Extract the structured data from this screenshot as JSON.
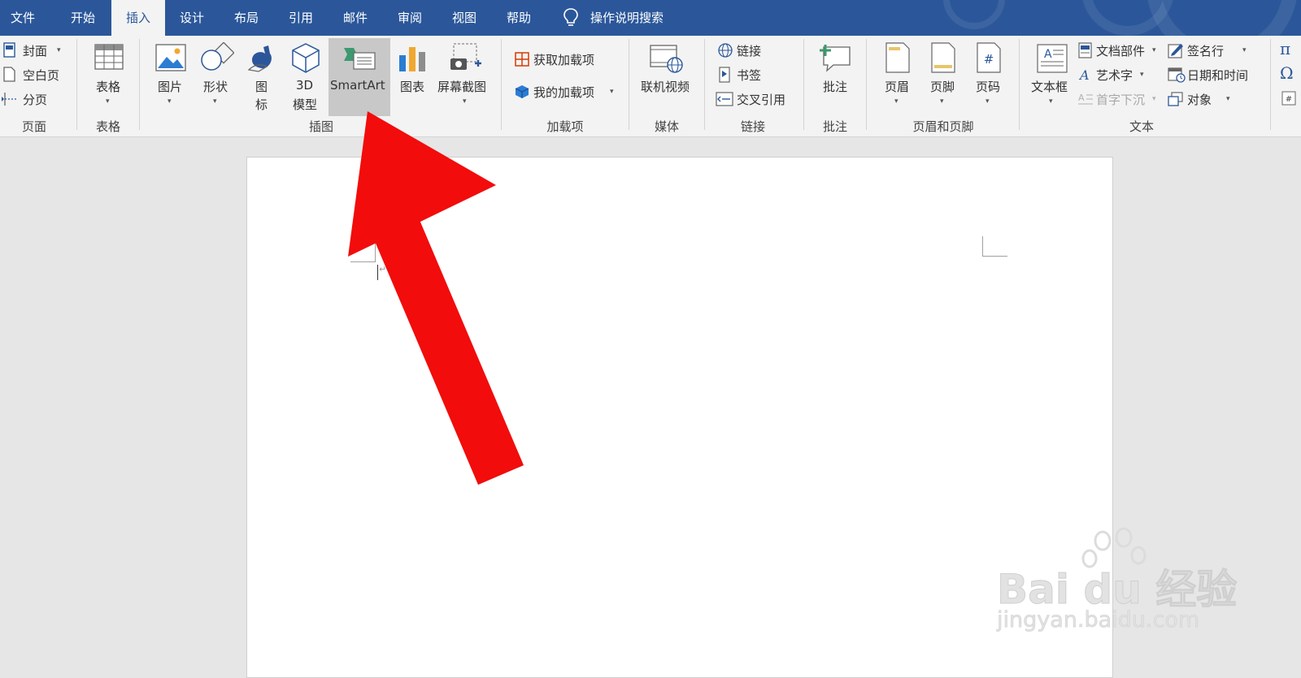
{
  "tabs": [
    {
      "label": "文件",
      "active": false
    },
    {
      "label": "开始",
      "active": false
    },
    {
      "label": "插入",
      "active": true
    },
    {
      "label": "设计",
      "active": false
    },
    {
      "label": "布局",
      "active": false
    },
    {
      "label": "引用",
      "active": false
    },
    {
      "label": "邮件",
      "active": false
    },
    {
      "label": "审阅",
      "active": false
    },
    {
      "label": "视图",
      "active": false
    },
    {
      "label": "帮助",
      "active": false
    }
  ],
  "tell_me": {
    "label": "操作说明搜索",
    "icon": "lightbulb-icon"
  },
  "groups": {
    "pages": {
      "label": "页面",
      "cover": "封面",
      "blank": "空白页",
      "break": "分页"
    },
    "tables": {
      "label": "表格",
      "table": "表格"
    },
    "illustrations": {
      "label": "插图",
      "pictures": "图片",
      "shapes": "形状",
      "icons_l1": "图",
      "icons_l2": "标",
      "model_l1": "3D",
      "model_l2": "模型",
      "smartart": "SmartArt",
      "chart": "图表",
      "screenshot": "屏幕截图"
    },
    "addins": {
      "label": "加载项",
      "get": "获取加载项",
      "mine": "我的加载项"
    },
    "media": {
      "label": "媒体",
      "video": "联机视频"
    },
    "links": {
      "label": "链接",
      "link": "链接",
      "bookmark": "书签",
      "crossref": "交叉引用"
    },
    "comments": {
      "label": "批注",
      "comment": "批注"
    },
    "header_footer": {
      "label": "页眉和页脚",
      "header": "页眉",
      "footer": "页脚",
      "page_number": "页码"
    },
    "text": {
      "label": "文本",
      "textbox": "文本框",
      "quick_parts": "文档部件",
      "wordart": "艺术字",
      "dropcap": "首字下沉",
      "signature": "签名行",
      "datetime": "日期和时间",
      "object": "对象"
    },
    "symbols": {
      "equation": "π",
      "symbol": "Ω"
    }
  },
  "colors": {
    "tabbar": "#2b579a",
    "ribbon": "#f3f3f3",
    "arrow": "#f20c0c",
    "selected_button": "#c8c8c8"
  },
  "watermark": {
    "brand": "Bai du 经验",
    "url": "jingyan.baidu.com"
  }
}
